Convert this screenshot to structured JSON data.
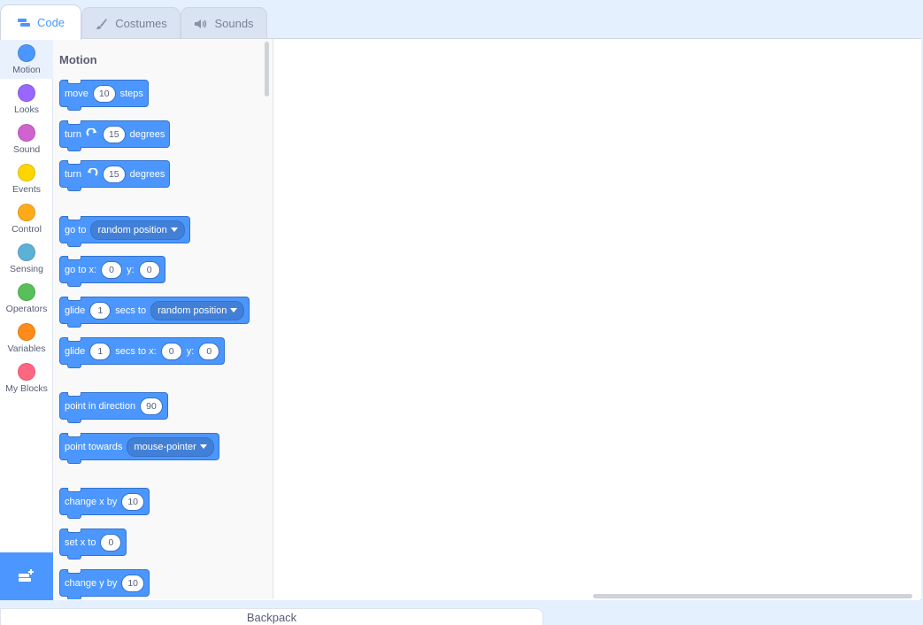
{
  "tabs": [
    {
      "label": "Code",
      "icon": "code-icon"
    },
    {
      "label": "Costumes",
      "icon": "brush-icon"
    },
    {
      "label": "Sounds",
      "icon": "speaker-icon"
    }
  ],
  "categories": [
    {
      "label": "Motion",
      "color": "#4c97ff"
    },
    {
      "label": "Looks",
      "color": "#9966ff"
    },
    {
      "label": "Sound",
      "color": "#cf63cf"
    },
    {
      "label": "Events",
      "color": "#ffd500"
    },
    {
      "label": "Control",
      "color": "#ffab19"
    },
    {
      "label": "Sensing",
      "color": "#5cb1d6"
    },
    {
      "label": "Operators",
      "color": "#59c059"
    },
    {
      "label": "Variables",
      "color": "#ff8c1a"
    },
    {
      "label": "My Blocks",
      "color": "#ff6680"
    }
  ],
  "palette": {
    "title": "Motion",
    "blocks": {
      "move": {
        "label": "move",
        "value": "10",
        "suffix": "steps"
      },
      "turn_right": {
        "label": "turn",
        "value": "15",
        "suffix": "degrees"
      },
      "turn_left": {
        "label": "turn",
        "value": "15",
        "suffix": "degrees"
      },
      "go_to": {
        "label": "go to",
        "option": "random position"
      },
      "go_to_xy": {
        "label": "go to x:",
        "x": "0",
        "y_label": "y:",
        "y": "0"
      },
      "glide_to": {
        "label": "glide",
        "secs": "1",
        "mid": "secs to",
        "option": "random position"
      },
      "glide_xy": {
        "label": "glide",
        "secs": "1",
        "mid": "secs to x:",
        "x": "0",
        "y_label": "y:",
        "y": "0"
      },
      "point_dir": {
        "label": "point in direction",
        "value": "90"
      },
      "point_towards": {
        "label": "point towards",
        "option": "mouse-pointer"
      },
      "change_x": {
        "label": "change x by",
        "value": "10"
      },
      "set_x": {
        "label": "set x to",
        "value": "0"
      },
      "change_y": {
        "label": "change y by",
        "value": "10"
      }
    }
  },
  "backpack": {
    "label": "Backpack"
  },
  "colors": {
    "accent": "#4c97ff",
    "block_border": "#3373cc"
  }
}
